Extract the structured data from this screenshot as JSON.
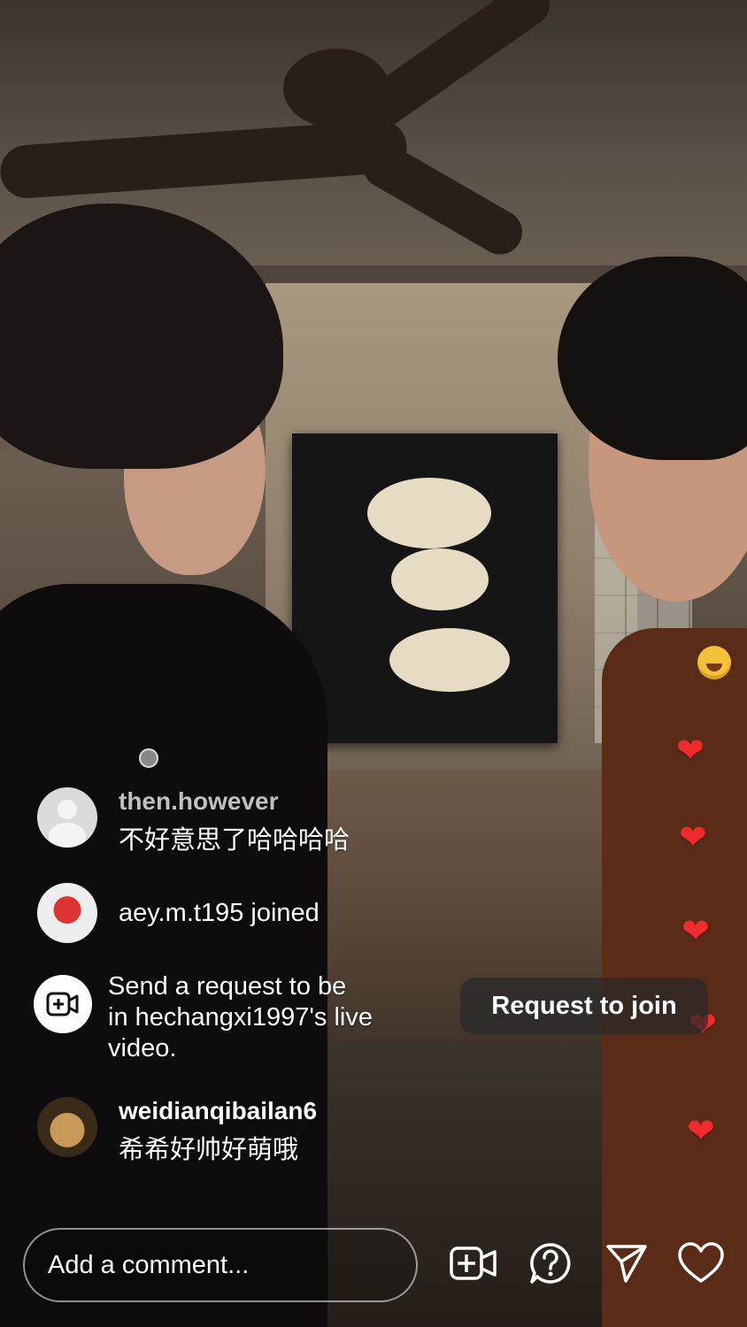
{
  "comments": [
    {
      "username": "then.however",
      "message": "不好意思了哈哈哈哈"
    },
    {
      "username": "aey.m.t195",
      "joined_suffix": "joined"
    },
    {
      "username": "weidianqibailan6",
      "message": "希希好帅好萌哦"
    }
  ],
  "request_notice": {
    "lines": [
      "Send a request to be",
      "in hechangxi1997's live",
      "video."
    ],
    "button_label": "Request to join"
  },
  "composer": {
    "placeholder": "Add a comment..."
  },
  "icons": {
    "request_video": "video-plus-icon",
    "question": "question-icon",
    "share": "send-icon",
    "like": "heart-icon",
    "hearts_color": "#ef2b2b"
  }
}
